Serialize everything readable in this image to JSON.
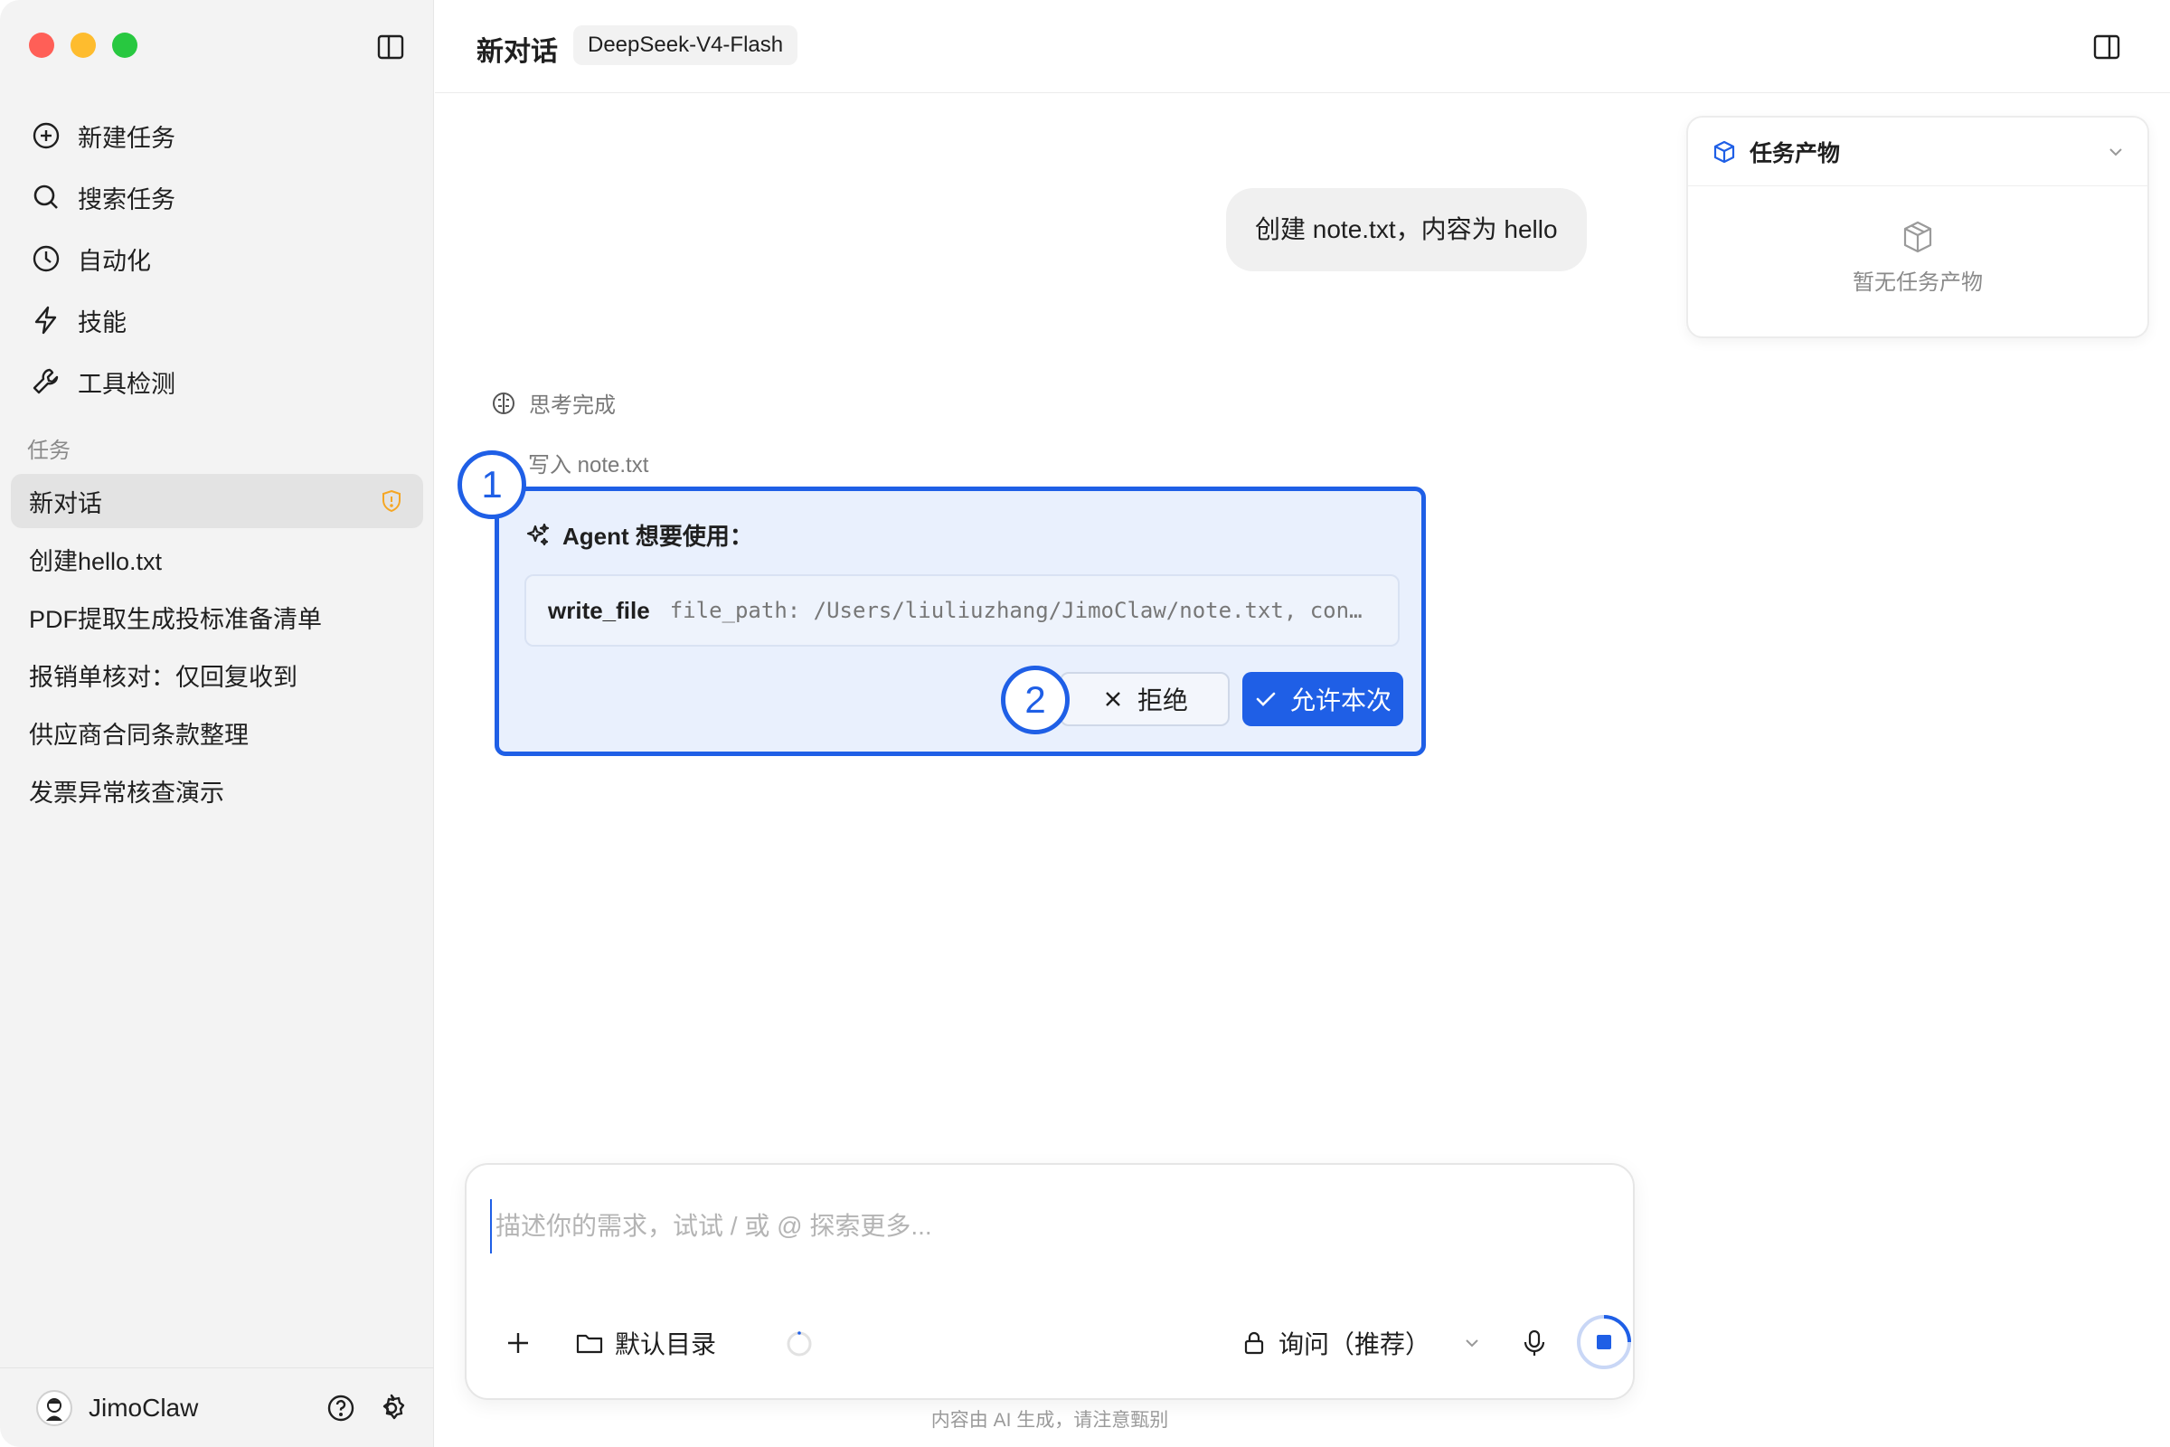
{
  "sidebar": {
    "nav": [
      {
        "label": "新建任务",
        "icon": "plus-circle-icon"
      },
      {
        "label": "搜索任务",
        "icon": "search-icon"
      },
      {
        "label": "自动化",
        "icon": "clock-icon"
      },
      {
        "label": "技能",
        "icon": "lightning-icon"
      },
      {
        "label": "工具检测",
        "icon": "wrench-icon"
      }
    ],
    "section_title": "任务",
    "tasks": [
      {
        "label": "新对话",
        "active": true
      },
      {
        "label": "创建hello.txt"
      },
      {
        "label": "PDF提取生成投标准备清单"
      },
      {
        "label": "报销单核对：仅回复收到"
      },
      {
        "label": "供应商合同条款整理"
      },
      {
        "label": "发票异常核查演示"
      }
    ],
    "user_name": "JimoClaw"
  },
  "header": {
    "title": "新对话",
    "model": "DeepSeek-V4-Flash"
  },
  "conversation": {
    "user_message": "创建 note.txt，内容为 hello",
    "thinking_status": "思考完成",
    "write_label": "写入 note.txt",
    "agent_request": {
      "title": "Agent 想要使用：",
      "tool_name": "write_file",
      "tool_args": "file_path: /Users/liuliuzhang/JimoClaw/note.txt, con…",
      "reject_label": "拒绝",
      "allow_label": "允许本次"
    }
  },
  "markers": [
    "1",
    "2"
  ],
  "artifacts": {
    "title": "任务产物",
    "empty_text": "暂无任务产物"
  },
  "composer": {
    "placeholder": "描述你的需求，试试 / 或 @ 探索更多...",
    "directory_label": "默认目录",
    "mode_label": "询问（推荐）"
  },
  "disclaimer": "内容由 AI 生成，请注意甄别",
  "colors": {
    "accent": "#1f5fe6",
    "sidebar_bg": "#f3f3f3",
    "shield_warning": "#f5a623"
  }
}
